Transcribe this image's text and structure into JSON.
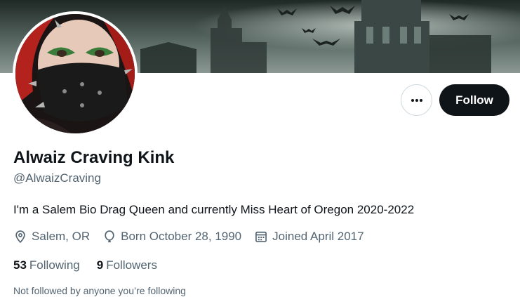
{
  "banner": {
    "alt": "gothic castle with bats header"
  },
  "avatar": {
    "alt": "profile photo"
  },
  "actions": {
    "more_icon": "more-horizontal-icon",
    "follow_label": "Follow"
  },
  "profile": {
    "display_name": "Alwaiz Craving Kink",
    "handle": "@AlwaizCraving",
    "bio": "I'm a Salem Bio Drag Queen and currently Miss Heart of Oregon 2020-2022",
    "location": "Salem, OR",
    "birthday": "Born October 28, 1990",
    "joined": "Joined April 2017"
  },
  "stats": {
    "following_count": "53",
    "following_label": "Following",
    "followers_count": "9",
    "followers_label": "Followers"
  },
  "social_context": "Not followed by anyone you’re following",
  "colors": {
    "primary_text": "#0f1419",
    "secondary_text": "#536471",
    "button_dark": "#0f1419",
    "border": "#cfd9de"
  }
}
